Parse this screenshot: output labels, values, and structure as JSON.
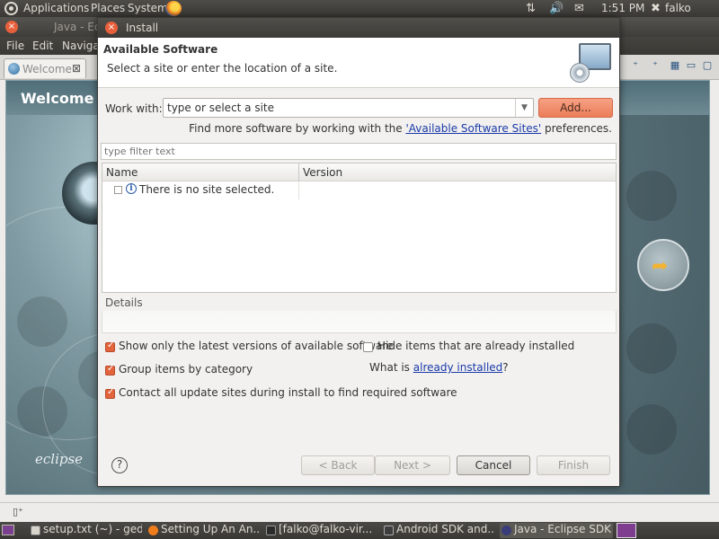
{
  "top_panel": {
    "applications": "Applications",
    "places": "Places",
    "system": "System",
    "time": "1:51 PM",
    "user": "falko"
  },
  "eclipse": {
    "title": "Java - Ec",
    "menu": {
      "file": "File",
      "edit": "Edit",
      "navigate": "Navigat"
    },
    "welcome_tab": "Welcome",
    "welcome_title": "Welcome to",
    "logo_text": "eclipse"
  },
  "dialog": {
    "title": "Install",
    "banner_title": "Available Software",
    "banner_desc": "Select a site or enter the location of a site.",
    "work_with_label": "Work with:",
    "site_value": "type or select a site",
    "add_label": "Add...",
    "find_more_prefix": "Find more software by working with the ",
    "find_more_link": "'Available Software Sites'",
    "find_more_suffix": " preferences.",
    "filter_placeholder": "type filter text",
    "table": {
      "col_name": "Name",
      "col_version": "Version",
      "rows": [
        {
          "name": "There is no site selected.",
          "version": ""
        }
      ]
    },
    "details_label": "Details",
    "options": {
      "latest_versions": "Show only the latest versions of available software",
      "hide_installed": "Hide items that are already installed",
      "group_category": "Group items by category",
      "what_is_prefix": "What is ",
      "already_installed_link": "already installed",
      "what_is_suffix": "?",
      "contact_sites": "Contact all update sites during install to find required software"
    },
    "buttons": {
      "back": "< Back",
      "next": "Next >",
      "cancel": "Cancel",
      "finish": "Finish"
    },
    "colors": {
      "accent": "#e2643d",
      "link": "#1a3aa8"
    }
  },
  "taskbar": {
    "tasks": [
      {
        "label": "setup.txt (~) - gedit"
      },
      {
        "label": "Setting Up An An..."
      },
      {
        "label": "[falko@falko-vir..."
      },
      {
        "label": "Android SDK and..."
      },
      {
        "label": "Java - Eclipse SDK"
      }
    ]
  }
}
